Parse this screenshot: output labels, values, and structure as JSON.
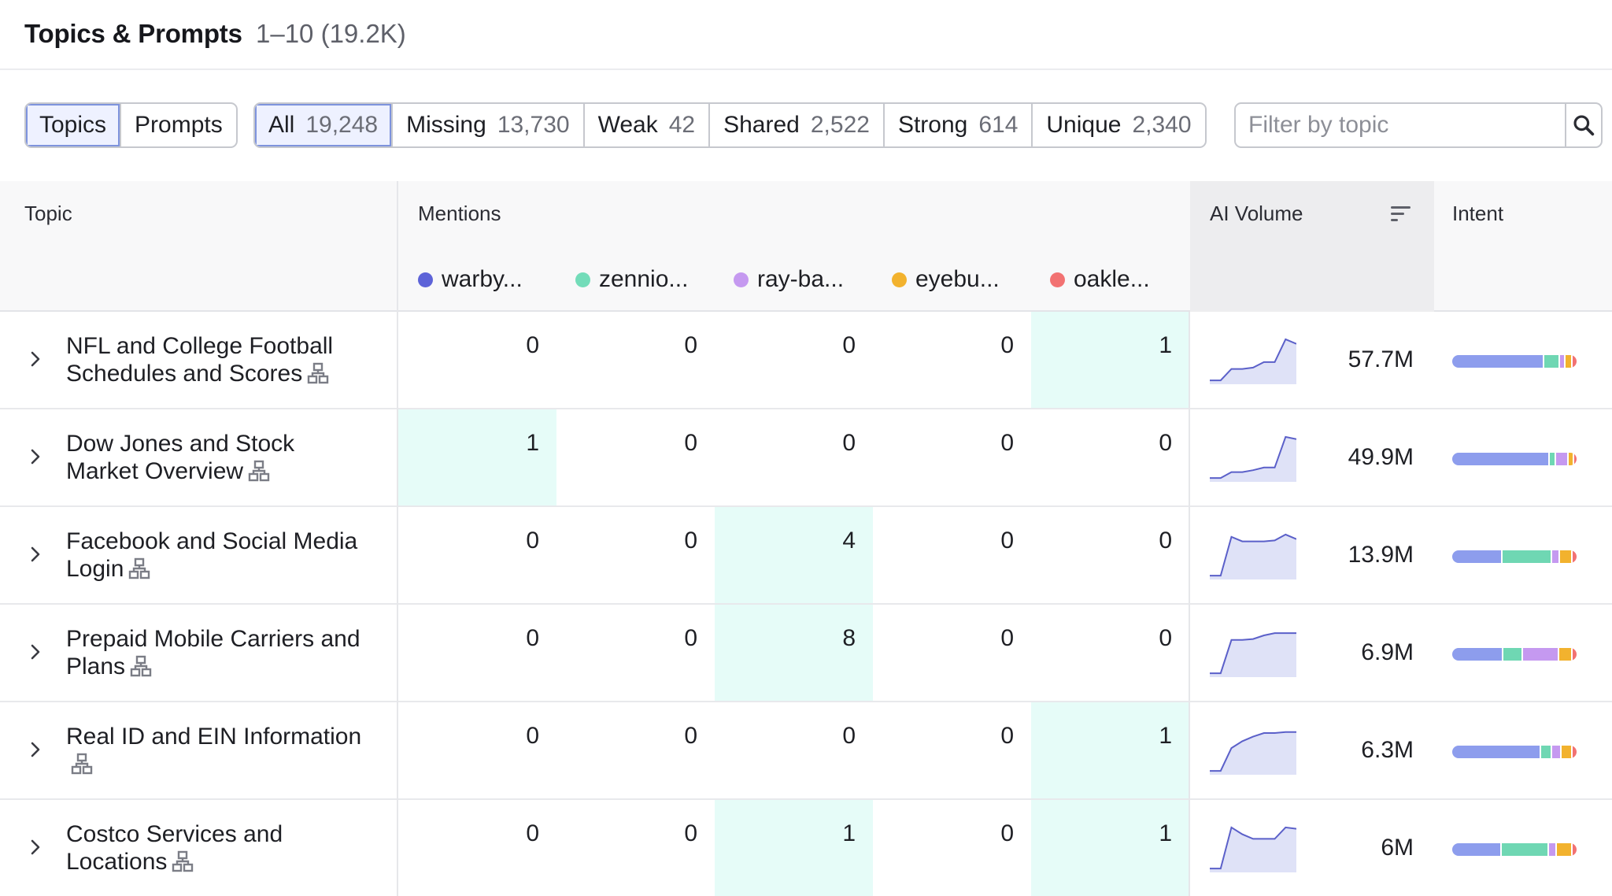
{
  "header": {
    "title": "Topics & Prompts",
    "range": "1–10 (19.2K)"
  },
  "view_tabs": [
    {
      "label": "Topics",
      "active": true
    },
    {
      "label": "Prompts",
      "active": false
    }
  ],
  "filter_tabs": [
    {
      "label": "All",
      "count": "19,248",
      "active": true
    },
    {
      "label": "Missing",
      "count": "13,730",
      "active": false
    },
    {
      "label": "Weak",
      "count": "42",
      "active": false
    },
    {
      "label": "Shared",
      "count": "2,522",
      "active": false
    },
    {
      "label": "Strong",
      "count": "614",
      "active": false
    },
    {
      "label": "Unique",
      "count": "2,340",
      "active": false
    }
  ],
  "search": {
    "placeholder": "Filter by topic"
  },
  "table": {
    "headers": {
      "topic": "Topic",
      "mentions": "Mentions",
      "ai_volume": "AI Volume",
      "intent": "Intent"
    },
    "brands": [
      {
        "name": "warby...",
        "color": "#5d63d8"
      },
      {
        "name": "zennio...",
        "color": "#73dcb9"
      },
      {
        "name": "ray-ba...",
        "color": "#c599f0"
      },
      {
        "name": "eyebu...",
        "color": "#f2b22e"
      },
      {
        "name": "oakle...",
        "color": "#f27272"
      }
    ],
    "intent_colors": [
      "#8d9ded",
      "#6fd7b3",
      "#c599f0",
      "#f2b22e",
      "#f27272"
    ],
    "rows": [
      {
        "topic": "NFL and College Football Schedules and Scores",
        "mentions": [
          "0",
          "0",
          "0",
          "0",
          "1"
        ],
        "ai_volume": "57.7M",
        "trend": [
          0.05,
          0.05,
          0.3,
          0.3,
          0.33,
          0.45,
          0.45,
          0.95,
          0.85
        ],
        "intent": [
          65,
          11,
          4,
          5,
          4
        ]
      },
      {
        "topic": "Dow Jones and Stock Market Overview",
        "mentions": [
          "1",
          "0",
          "0",
          "0",
          "0"
        ],
        "ai_volume": "49.9M",
        "trend": [
          0.05,
          0.05,
          0.18,
          0.18,
          0.22,
          0.28,
          0.28,
          0.95,
          0.9
        ],
        "intent": [
          70,
          5,
          9,
          4,
          3
        ]
      },
      {
        "topic": "Facebook and Social Media Login",
        "mentions": [
          "0",
          "0",
          "4",
          "0",
          "0"
        ],
        "ai_volume": "13.9M",
        "trend": [
          0.05,
          0.05,
          0.9,
          0.8,
          0.8,
          0.8,
          0.82,
          0.95,
          0.85
        ],
        "intent": [
          38,
          39,
          6,
          10,
          4
        ]
      },
      {
        "topic": "Prepaid Mobile Carriers and Plans",
        "mentions": [
          "0",
          "0",
          "8",
          "0",
          "0"
        ],
        "ai_volume": "6.9M",
        "trend": [
          0.05,
          0.05,
          0.78,
          0.78,
          0.8,
          0.88,
          0.93,
          0.93,
          0.93
        ],
        "intent": [
          37,
          15,
          27,
          10,
          4
        ]
      },
      {
        "topic": "Real ID and EIN Information",
        "mentions": [
          "0",
          "0",
          "0",
          "0",
          "1"
        ],
        "ai_volume": "6.3M",
        "trend": [
          0.05,
          0.05,
          0.55,
          0.7,
          0.8,
          0.88,
          0.88,
          0.9,
          0.9
        ],
        "intent": [
          64,
          8,
          7,
          8,
          4
        ]
      },
      {
        "topic": "Costco Services and Locations",
        "mentions": [
          "0",
          "0",
          "1",
          "0",
          "1"
        ],
        "ai_volume": "6M",
        "trend": [
          0.05,
          0.05,
          0.95,
          0.8,
          0.7,
          0.7,
          0.7,
          0.95,
          0.92
        ],
        "intent": [
          36,
          35,
          6,
          12,
          4
        ]
      }
    ]
  }
}
